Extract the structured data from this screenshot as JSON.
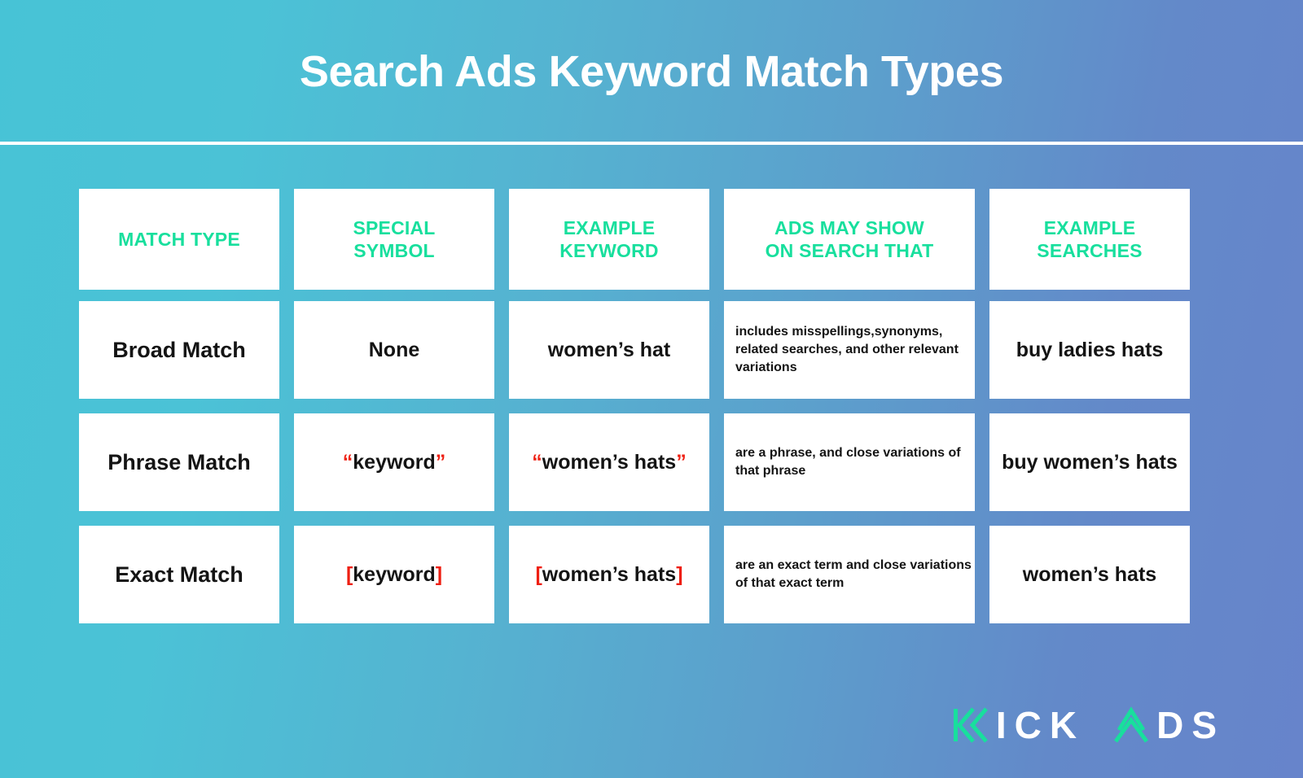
{
  "title": "Search Ads Keyword Match Types",
  "colors": {
    "background_left": "#47C3D6",
    "background_right": "#6784CB",
    "header_text": "#18DF9D",
    "symbol_accent": "#EE1F12",
    "cell_background": "#FFFFFF",
    "body_text": "#141414",
    "logo_accent": "#18DF9D",
    "logo_text": "#FFFFFF"
  },
  "table": {
    "headers": [
      "MATCH TYPE",
      "SPECIAL\nSYMBOL",
      "EXAMPLE\nKEYWORD",
      "ADS MAY SHOW\nON SEARCH THAT",
      "EXAMPLE\nSEARCHES"
    ],
    "rows": [
      {
        "match_type": "Broad Match",
        "special_symbol_prefix": "",
        "special_symbol_core": "None",
        "special_symbol_suffix": "",
        "example_keyword_prefix": "",
        "example_keyword_core": "women’s hat",
        "example_keyword_suffix": "",
        "ads_may_show": "includes misspellings,synonyms, related searches, and other relevant variations",
        "example_searches": "buy ladies hats"
      },
      {
        "match_type": "Phrase Match",
        "special_symbol_prefix": "“",
        "special_symbol_core": "keyword",
        "special_symbol_suffix": "”",
        "example_keyword_prefix": "“",
        "example_keyword_core": "women’s hats",
        "example_keyword_suffix": "”",
        "ads_may_show": "are a phrase, and close variations of that phrase",
        "example_searches": "buy women’s hats"
      },
      {
        "match_type": "Exact Match",
        "special_symbol_prefix": "[",
        "special_symbol_core": "keyword",
        "special_symbol_suffix": "]",
        "example_keyword_prefix": "[",
        "example_keyword_core": "women’s hats",
        "example_keyword_suffix": "]",
        "ads_may_show": "are an exact term and close variations of that exact term",
        "example_searches": "women’s hats"
      }
    ]
  },
  "logo": {
    "brand_first": "ICK",
    "brand_second": "DS",
    "k_icon": "double-chevron-left-icon",
    "a_icon": "double-chevron-up-icon",
    "full_name": "KICK ADS"
  }
}
